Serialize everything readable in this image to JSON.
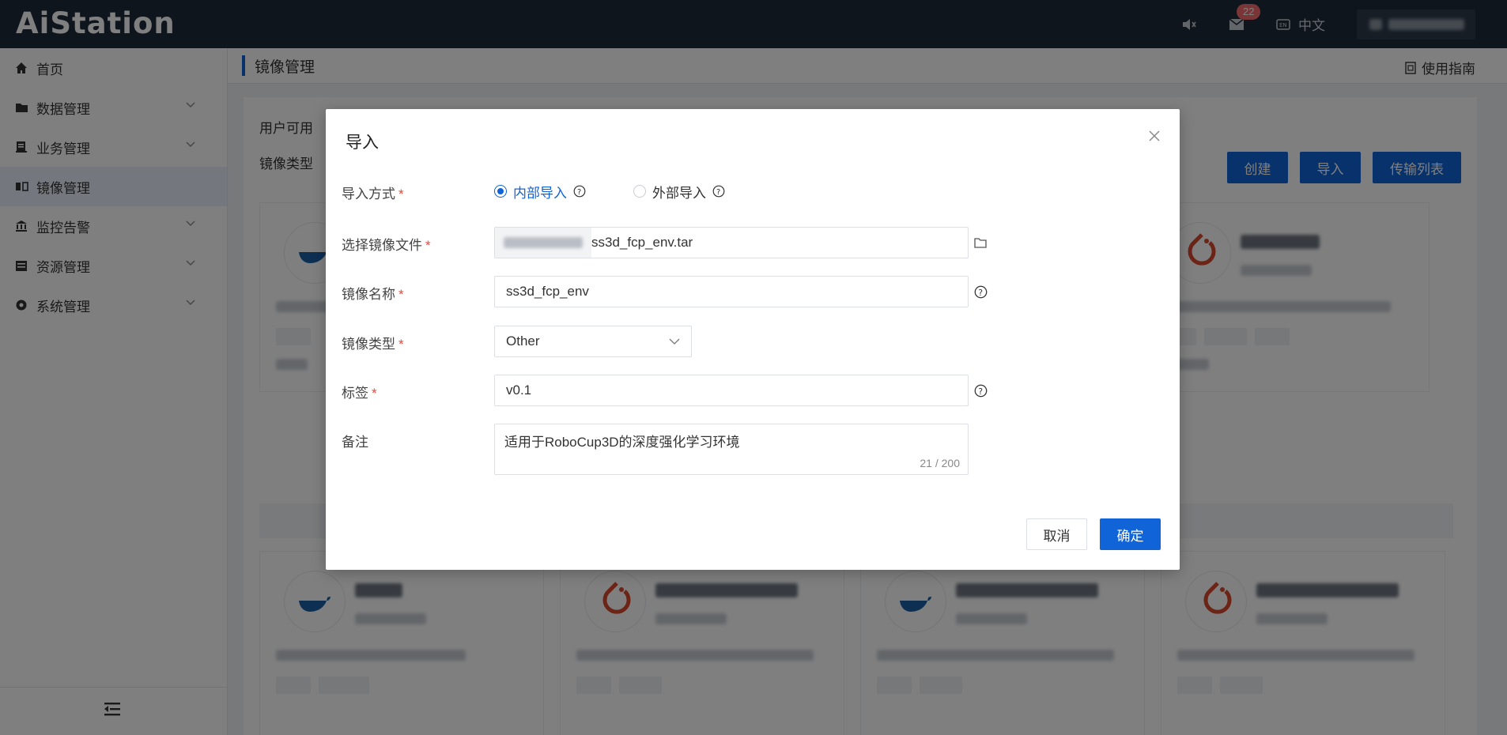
{
  "app": {
    "logo": "AiStation"
  },
  "topbar": {
    "mail_count": "22",
    "language": "中文"
  },
  "sidebar": {
    "items": [
      {
        "label": "首页",
        "icon": "home-icon"
      },
      {
        "label": "数据管理",
        "icon": "folder-icon"
      },
      {
        "label": "业务管理",
        "icon": "book-icon"
      },
      {
        "label": "镜像管理",
        "icon": "mirror-icon"
      },
      {
        "label": "监控告警",
        "icon": "bank-icon"
      },
      {
        "label": "资源管理",
        "icon": "resource-icon"
      },
      {
        "label": "系统管理",
        "icon": "system-icon"
      }
    ]
  },
  "page": {
    "title": "镜像管理",
    "guide": "使用指南",
    "filter_user": "用户可用",
    "filter_type": "镜像类型",
    "actions": {
      "create": "创建",
      "import": "导入",
      "transfer": "传输列表"
    }
  },
  "modal": {
    "title": "导入",
    "import_method": {
      "label": "导入方式",
      "options": [
        "内部导入",
        "外部导入"
      ],
      "selected": "内部导入"
    },
    "file": {
      "label": "选择镜像文件",
      "value": "ss3d_fcp_env.tar"
    },
    "name": {
      "label": "镜像名称",
      "value": "ss3d_fcp_env"
    },
    "type": {
      "label": "镜像类型",
      "value": "Other"
    },
    "tag": {
      "label": "标签",
      "value": "v0.1"
    },
    "note": {
      "label": "备注",
      "value": "适用于RoboCup3D的深度强化学习环境",
      "count": "21 / 200"
    },
    "cancel": "取消",
    "confirm": "确定"
  },
  "colors": {
    "primary": "#1064d8",
    "topbar": "#1e2a3a",
    "required": "#e8463a"
  }
}
